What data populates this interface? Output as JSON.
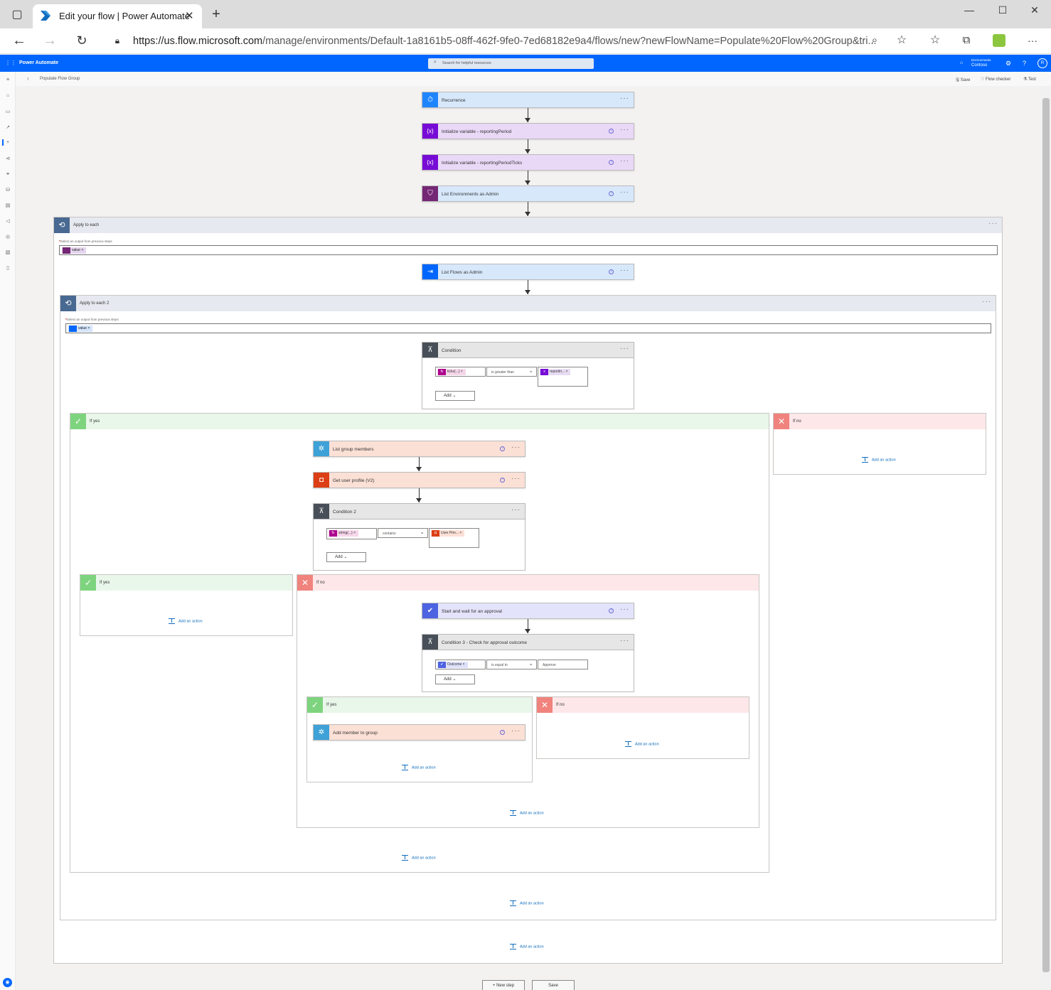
{
  "browser": {
    "tab_title": "Edit your flow | Power Automate",
    "url_host": "https://us.flow.microsoft.com",
    "url_path": "/manage/environments/Default-1a8161b5-08ff-462f-9fe0-7ed68182e9a4/flows/new?newFlowName=Populate%20Flow%20Group&tri..."
  },
  "app": {
    "brand": "Power Automate",
    "search_placeholder": "Search for helpful resources",
    "env_label": "Environments",
    "env_value": "Contoso",
    "user_initials": "R"
  },
  "commandbar": {
    "breadcrumb": "Populate Flow Group",
    "save": "Save",
    "flow_checker": "Flow checker",
    "test": "Test"
  },
  "actions": {
    "recurrence": "Recurrence",
    "init_var1": "Initialize variable - reportingPeriod",
    "init_var2": "Initialize variable - reportingPeriodTicks",
    "list_envs": "List Environments as Admin",
    "apply1": "Apply to each",
    "select_output_label": "Select an output from previous steps",
    "value_token": "value",
    "list_flows": "List Flows as Admin",
    "apply2": "Apply to each 2",
    "condition": "Condition",
    "cond1_left": "ticks(...)",
    "cond1_op": "is greater than",
    "cond1_right": "reportin...",
    "add_label": "Add",
    "if_yes": "If yes",
    "if_no": "If no",
    "list_members": "List group members",
    "get_profile": "Get user profile (V2)",
    "condition2": "Condition 2",
    "cond2_left": "string(...)",
    "cond2_op": "contains",
    "cond2_right": "User Prin...",
    "approval": "Start and wait for an approval",
    "condition3": "Condition 3 - Check for approval outcome",
    "cond3_left": "Outcome",
    "cond3_op": "is equal to",
    "cond3_right": "Approve",
    "add_member": "Add member to group",
    "add_an_action": "Add an action"
  },
  "footer": {
    "new_step": "+ New step",
    "save": "Save"
  },
  "colors": {
    "header_blue": "#0066ff",
    "recurrence": "#1f85ff",
    "variable": "#770bd6",
    "admin": "#742774",
    "list_flows": "#0066ff",
    "control": "#484f58",
    "groups": "#3ea1d7",
    "office": "#dc3e15",
    "approval": "#4e63e1"
  }
}
